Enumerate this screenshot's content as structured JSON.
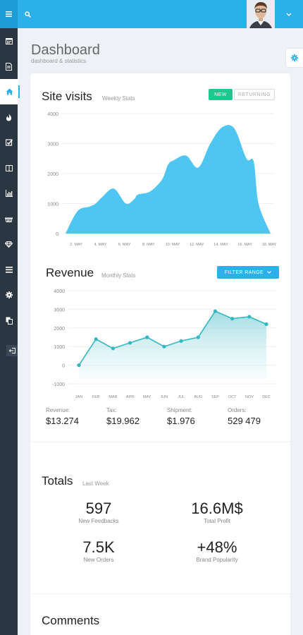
{
  "header": {
    "menu_icon": "hamburger-icon",
    "search_icon": "search-icon",
    "dropdown_icon": "chevron-down-icon"
  },
  "sidebar": {
    "items": [
      {
        "icon": "calendar-icon",
        "active": false
      },
      {
        "icon": "document-icon",
        "active": false
      },
      {
        "icon": "home-icon",
        "active": true
      },
      {
        "icon": "fire-icon",
        "active": false
      },
      {
        "icon": "checkbox-icon",
        "active": false
      },
      {
        "icon": "columns-icon",
        "active": false
      },
      {
        "icon": "bar-chart-icon",
        "active": false
      },
      {
        "icon": "basket-icon",
        "active": false
      },
      {
        "icon": "diamond-icon",
        "active": false
      },
      {
        "icon": "list-icon",
        "active": false
      },
      {
        "icon": "gear-icon",
        "active": false
      },
      {
        "icon": "copy-icon",
        "active": false
      }
    ],
    "logout_icon": "logout-icon"
  },
  "page": {
    "title": "Dashboard",
    "subtitle": "dashboard & statistics"
  },
  "site_visits": {
    "title": "Site visits",
    "subtitle": "Weekly Stats",
    "btn_new": "NEW",
    "btn_returning": "RETURNING"
  },
  "revenue": {
    "title": "Revenue",
    "subtitle": "Monthly Stats",
    "filter_label": "FILTER RANGE"
  },
  "stats": {
    "revenue_label": "Revenue:",
    "revenue_value": "$13.274",
    "tax_label": "Tax:",
    "tax_value": "$19.962",
    "shipment_label": "Shipment:",
    "shipment_value": "$1.976",
    "orders_label": "Orders:",
    "orders_value": "529 479"
  },
  "totals": {
    "title": "Totals",
    "subtitle": "Last Week",
    "feedbacks_value": "597",
    "feedbacks_label": "New Feedbacks",
    "profit_value": "16.6M$",
    "profit_label": "Total Profit",
    "orders_value": "7.5K",
    "orders_label": "New Orders",
    "popularity_value": "+48%",
    "popularity_label": "Brand Popularity"
  },
  "comments": {
    "title": "Comments"
  },
  "colors": {
    "accent": "#2bb0ea",
    "sidebar": "#2b3643",
    "new_button": "#1ec78e",
    "area_fill": "#4fc6f2",
    "line_teal": "#33b8c1"
  },
  "chart_data": [
    {
      "type": "area",
      "categories": [
        "2. MAY",
        "4. MAY",
        "6. MAY",
        "8. MAY",
        "10. MAY",
        "12. MAY",
        "14. MAY",
        "16. MAY",
        "18. MAY"
      ],
      "x": [
        1,
        2,
        3,
        3.5,
        4,
        5,
        6,
        6.7,
        7,
        8,
        9,
        9.5,
        10,
        11,
        12,
        13,
        14,
        15,
        16,
        16.6,
        17,
        18
      ],
      "values": [
        0,
        750,
        900,
        1000,
        1200,
        1500,
        1000,
        1150,
        1300,
        1400,
        1800,
        2300,
        2450,
        2600,
        2200,
        3000,
        3550,
        3500,
        2500,
        2400,
        1000,
        0
      ],
      "ylim": [
        0,
        4000
      ],
      "yticks": [
        "0",
        "1000",
        "2000",
        "3000",
        "4000"
      ],
      "grid": true
    },
    {
      "type": "line",
      "categories": [
        "JAN",
        "FEB",
        "MAR",
        "APR",
        "MAY",
        "JUN",
        "JUL",
        "AUG",
        "SEP",
        "OCT",
        "NOV",
        "DEC"
      ],
      "values": [
        0,
        1400,
        900,
        1200,
        1500,
        1000,
        1300,
        1500,
        2900,
        2500,
        2600,
        2200
      ],
      "ylim": [
        -1000,
        4000
      ],
      "yticks": [
        "-1000",
        "0",
        "1000",
        "2000",
        "3000",
        "4000"
      ],
      "grid": true
    }
  ]
}
